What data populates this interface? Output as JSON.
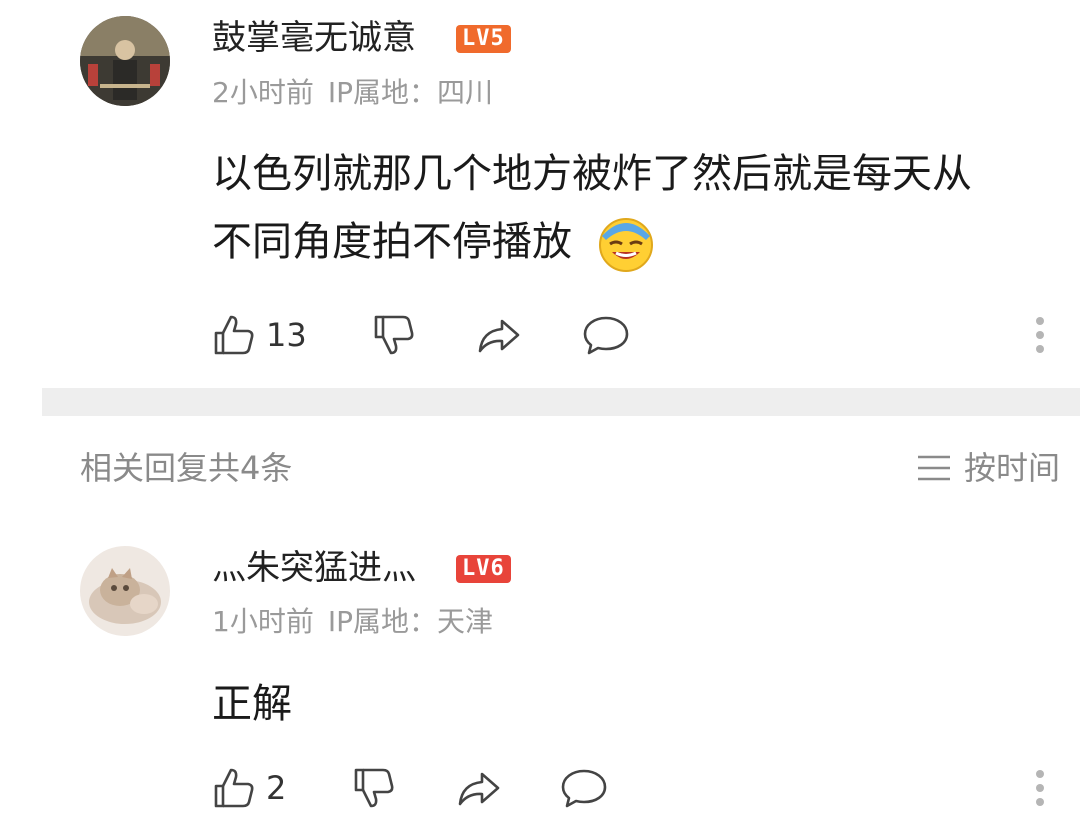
{
  "comment": {
    "username": "鼓掌毫无诚意",
    "level_badge": "LV5",
    "level_color": "#f06a2c",
    "time": "2小时前",
    "ip_label": "IP属地：四川",
    "content_line1": "以色列就那几个地方被炸了然后就是每天从",
    "content_line2": "不同角度拍不停播放",
    "emoji": "sweat-laugh-emoji",
    "like_count": "13"
  },
  "replies_header": {
    "label": "相关回复共4条",
    "sort_label": "按时间",
    "sort_icon": "sort-lines-icon"
  },
  "reply": {
    "username": "灬朱突猛进灬",
    "level_badge": "LV6",
    "level_color": "#e8443a",
    "time": "1小时前",
    "ip_label": "IP属地：天津",
    "content": "正解",
    "like_count": "2"
  },
  "icons": {
    "like": "thumbs-up-icon",
    "dislike": "thumbs-down-icon",
    "share": "share-arrow-icon",
    "comment": "comment-bubble-icon",
    "more": "more-vertical-icon"
  }
}
